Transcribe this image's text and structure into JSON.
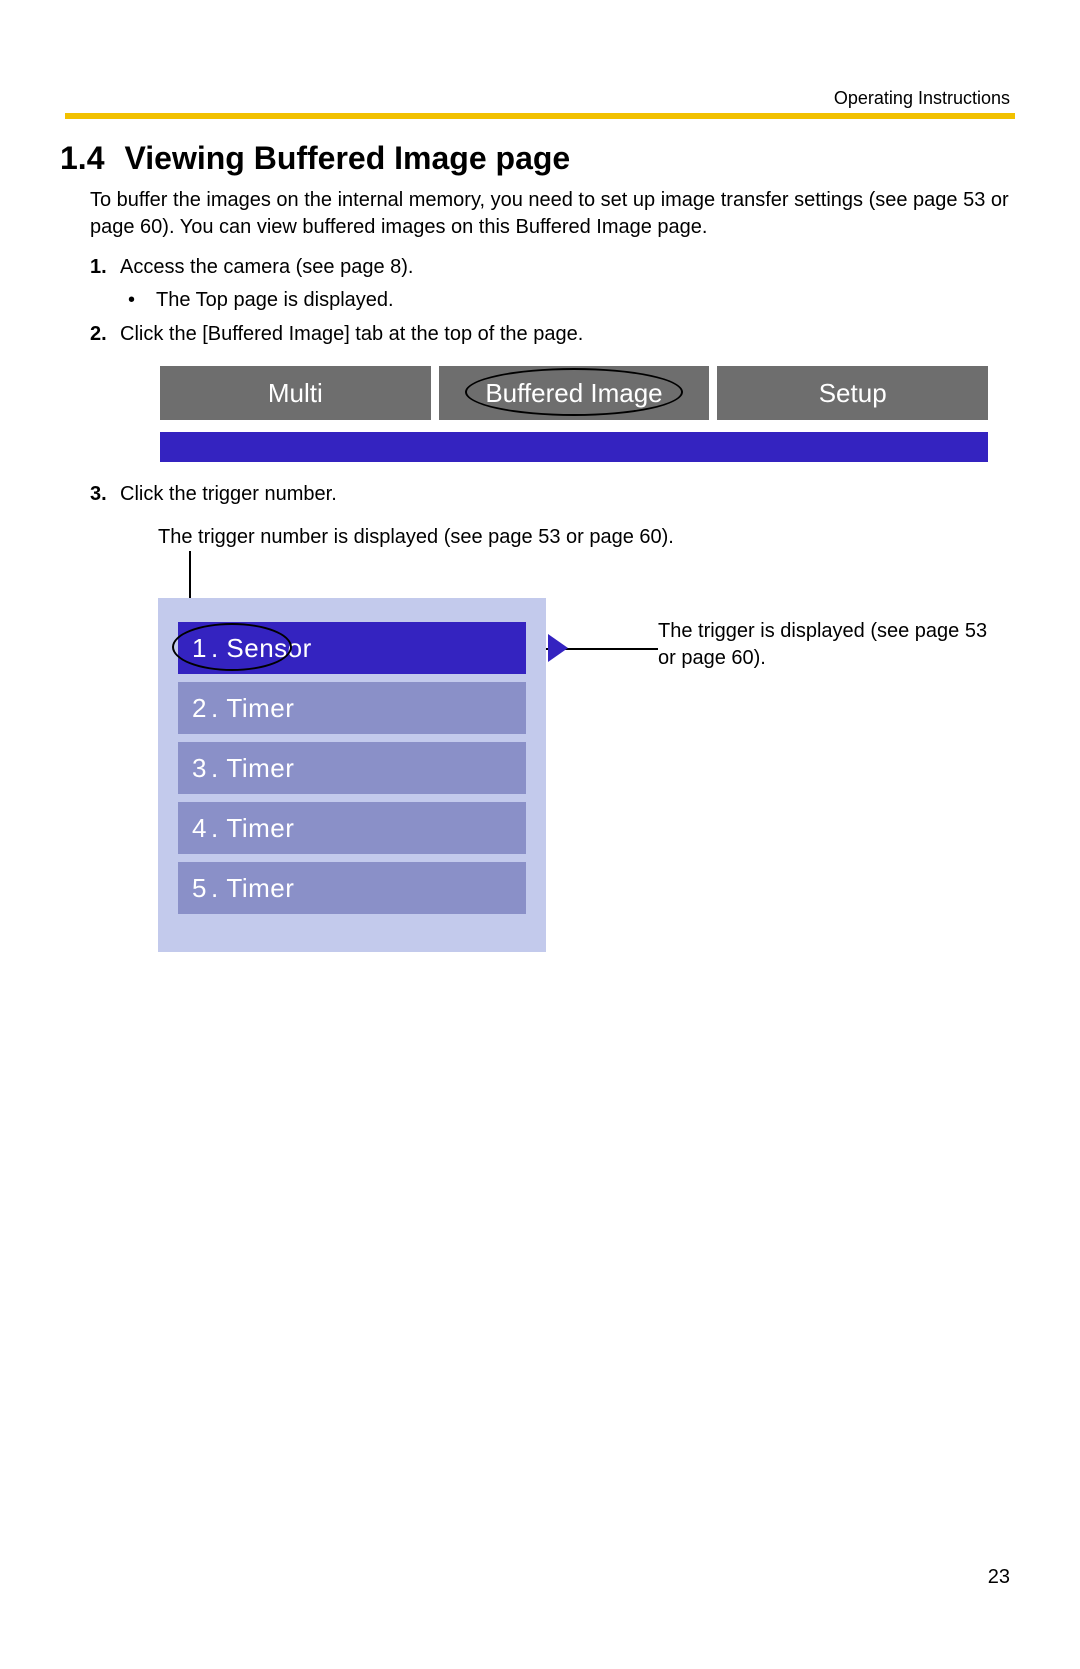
{
  "header": {
    "label": "Operating Instructions"
  },
  "section": {
    "number": "1.4",
    "title": "Viewing Buffered Image page",
    "intro": "To buffer the images on the internal memory, you need to set up image transfer settings (see page 53 or page 60). You can view buffered images on this Buffered Image page."
  },
  "steps": [
    {
      "num": "1.",
      "text": "Access the camera (see page 8).",
      "sub": [
        {
          "bullet": "•",
          "text": "The Top page is displayed."
        }
      ]
    },
    {
      "num": "2.",
      "text": "Click the [Buffered Image] tab at the top of the page.",
      "sub": []
    },
    {
      "num": "3.",
      "text": "Click the trigger number.",
      "sub": []
    }
  ],
  "tabs": {
    "items": [
      "Multi",
      "Buffered Image",
      "Setup"
    ]
  },
  "trigger_figure": {
    "caption_top": "The trigger number is displayed (see page 53 or page 60).",
    "items": [
      {
        "num": "1",
        "label": "Sensor",
        "active": true
      },
      {
        "num": "2",
        "label": "Timer",
        "active": false
      },
      {
        "num": "3",
        "label": "Timer",
        "active": false
      },
      {
        "num": "4",
        "label": "Timer",
        "active": false
      },
      {
        "num": "5",
        "label": "Timer",
        "active": false
      }
    ],
    "callout_right": "The trigger is displayed (see page 53 or page 60)."
  },
  "page_number": "23"
}
